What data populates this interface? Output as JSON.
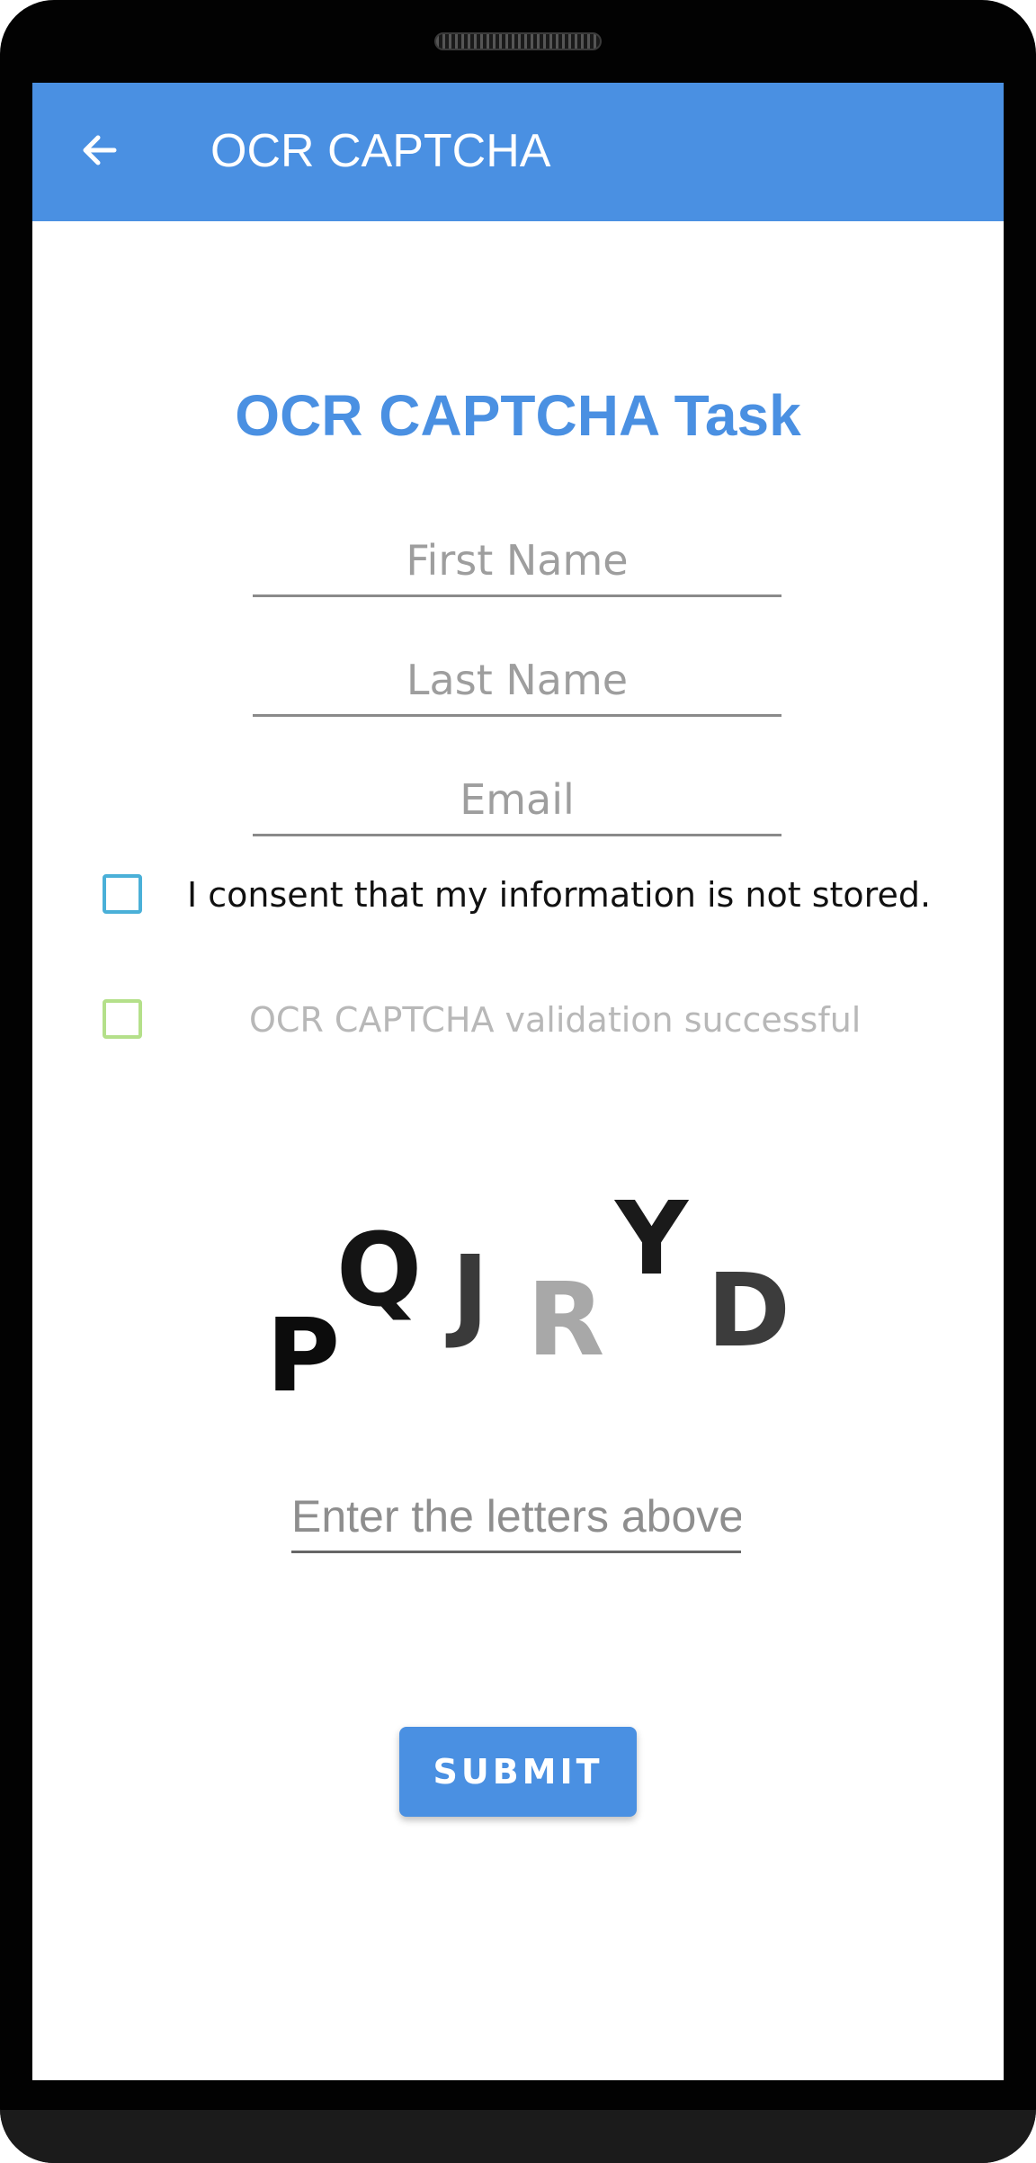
{
  "appbar": {
    "title": "OCR CAPTCHA",
    "back_icon": "arrow-left-icon",
    "color": "#4a90e2"
  },
  "form": {
    "heading": "OCR CAPTCHA Task",
    "first_name_placeholder": "First Name",
    "last_name_placeholder": "Last Name",
    "email_placeholder": "Email",
    "first_name_value": "",
    "last_name_value": "",
    "email_value": ""
  },
  "consent": {
    "label": "I consent that my information is not stored.",
    "checked": false
  },
  "validation": {
    "label": "OCR CAPTCHA validation successful",
    "checked": false
  },
  "captcha": {
    "letters": [
      "P",
      "Q",
      "J",
      "R",
      "Y",
      "D"
    ],
    "input_placeholder": "Enter the letters above",
    "input_value": ""
  },
  "submit_label": "SUBMIT"
}
